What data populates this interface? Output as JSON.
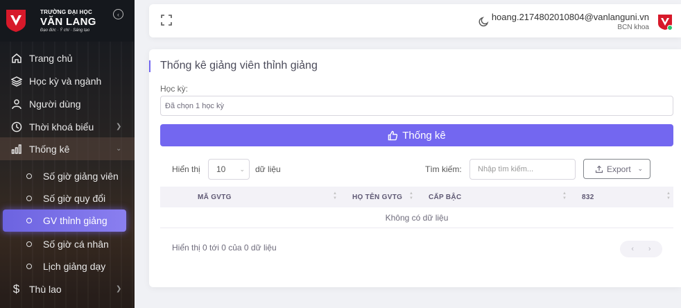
{
  "brand": {
    "line1": "TRƯỜNG ĐẠI HỌC",
    "line2": "VĂN LANG",
    "tagline": "Đạo đức · Ý chí · Sáng tạo",
    "color": "#d7192a"
  },
  "sidebar": {
    "items": [
      {
        "label": "Trang chủ",
        "icon": "home-icon"
      },
      {
        "label": "Học kỳ và ngành",
        "icon": "layers-icon"
      },
      {
        "label": "Người dùng",
        "icon": "user-icon"
      },
      {
        "label": "Thời khoá biểu",
        "icon": "clock-icon"
      },
      {
        "label": "Thống kê",
        "icon": "bar-chart-icon"
      }
    ],
    "subitems": [
      {
        "label": "Số giờ giảng viên"
      },
      {
        "label": "Số giờ quy đổi"
      },
      {
        "label": "GV thỉnh giảng"
      },
      {
        "label": "Số giờ cá nhân"
      },
      {
        "label": "Lịch giảng dạy"
      }
    ],
    "last_item": {
      "label": "Thù lao",
      "icon": "dollar-icon"
    },
    "active_subitem": "GV thỉnh giảng"
  },
  "navbar": {
    "email": "hoang.2174802010804@vanlanguni.vn",
    "role": "BCN khoa"
  },
  "card": {
    "title": "Thống kê giảng viên thỉnh giảng",
    "semester_label": "Học kỳ:",
    "semester_value": "Đã chọn 1 học kỳ",
    "stat_button": "Thống kê",
    "show_label": "Hiển thị",
    "page_size": "10",
    "entries_label": "dữ liệu",
    "search_label": "Tìm kiếm:",
    "search_placeholder": "Nhập tìm kiếm...",
    "export_label": "Export",
    "columns": [
      "MÃ GVTG",
      "HỌ TÊN GVTG",
      "CẤP BẬC",
      "832"
    ],
    "empty_text": "Không có dữ liệu",
    "info_text": "Hiển thị 0 tới 0 của 0 dữ liệu",
    "pager_prev": "‹",
    "pager_next": "›"
  },
  "colors": {
    "accent": "#7367f0",
    "sidebar_bg": "#15181d",
    "online": "#28c76f"
  }
}
